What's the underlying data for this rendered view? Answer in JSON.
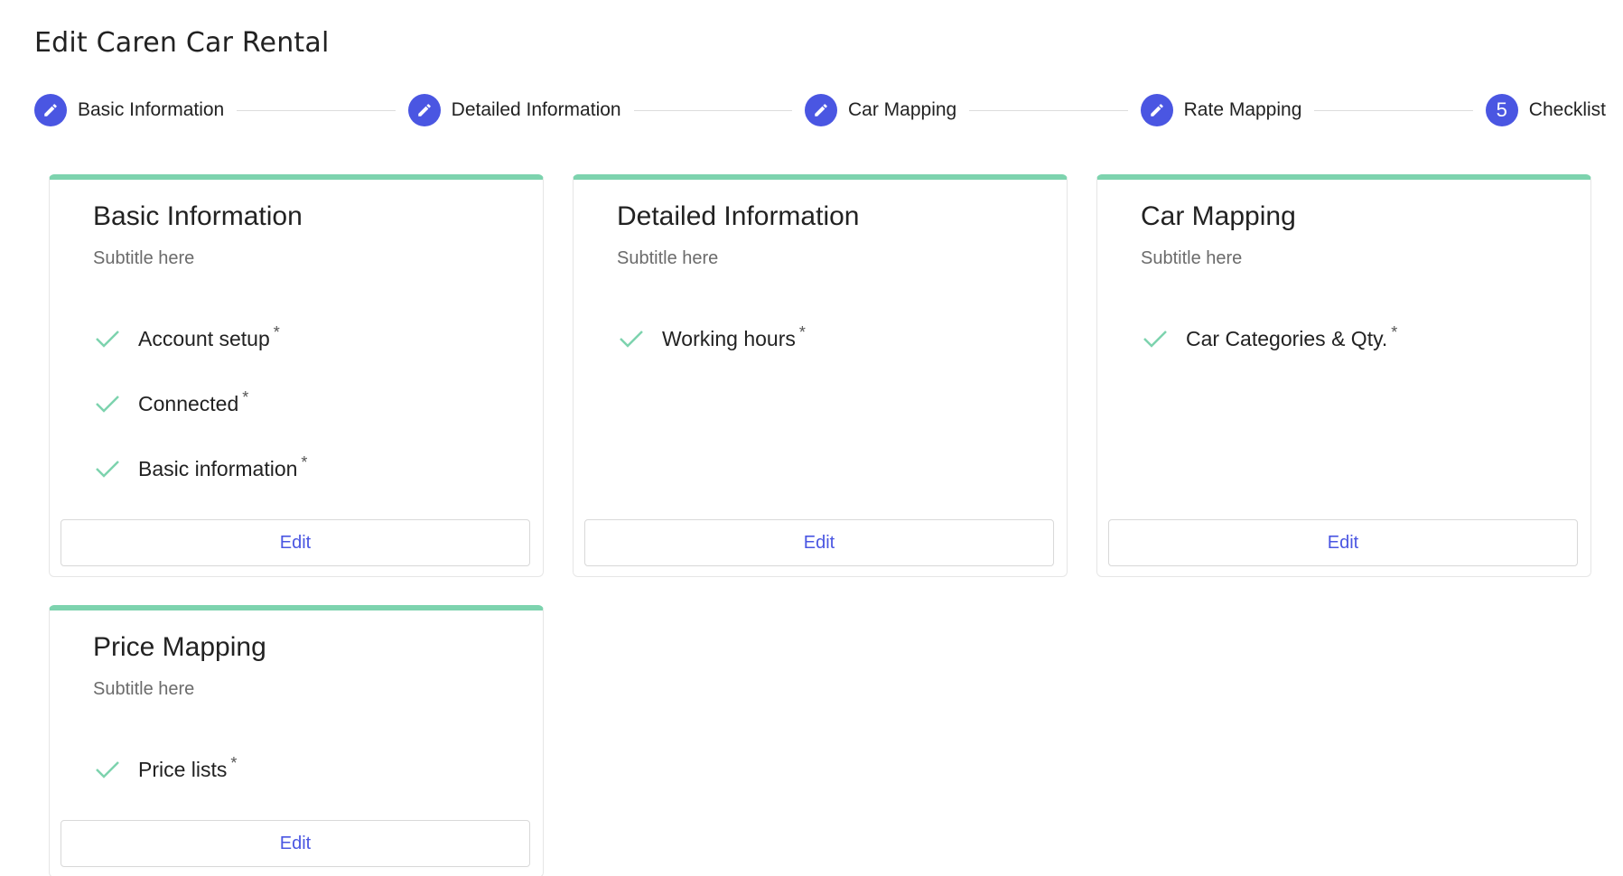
{
  "page": {
    "title": "Edit Caren Car Rental"
  },
  "stepper": {
    "steps": [
      {
        "label": "Basic Information",
        "icon": "pencil-icon",
        "number": ""
      },
      {
        "label": "Detailed Information",
        "icon": "pencil-icon",
        "number": ""
      },
      {
        "label": "Car Mapping",
        "icon": "pencil-icon",
        "number": ""
      },
      {
        "label": "Rate Mapping",
        "icon": "pencil-icon",
        "number": ""
      },
      {
        "label": "Checklist",
        "icon": "",
        "number": "5"
      }
    ]
  },
  "cards": [
    {
      "title": "Basic Information",
      "subtitle": "Subtitle here",
      "items": [
        {
          "label": "Account setup",
          "required": "*"
        },
        {
          "label": "Connected",
          "required": "*"
        },
        {
          "label": "Basic information",
          "required": "*"
        }
      ],
      "edit_label": "Edit"
    },
    {
      "title": "Detailed Information",
      "subtitle": "Subtitle here",
      "items": [
        {
          "label": "Working hours",
          "required": "*"
        }
      ],
      "edit_label": "Edit"
    },
    {
      "title": "Car Mapping",
      "subtitle": "Subtitle here",
      "items": [
        {
          "label": "Car Categories & Qty.",
          "required": "*"
        }
      ],
      "edit_label": "Edit"
    },
    {
      "title": "Price Mapping",
      "subtitle": "Subtitle here",
      "items": [
        {
          "label": "Price lists",
          "required": "*"
        }
      ],
      "edit_label": "Edit"
    }
  ],
  "colors": {
    "accent": "#4a56e2",
    "card_top": "#7dd3ae",
    "check": "#7dd3ae"
  }
}
